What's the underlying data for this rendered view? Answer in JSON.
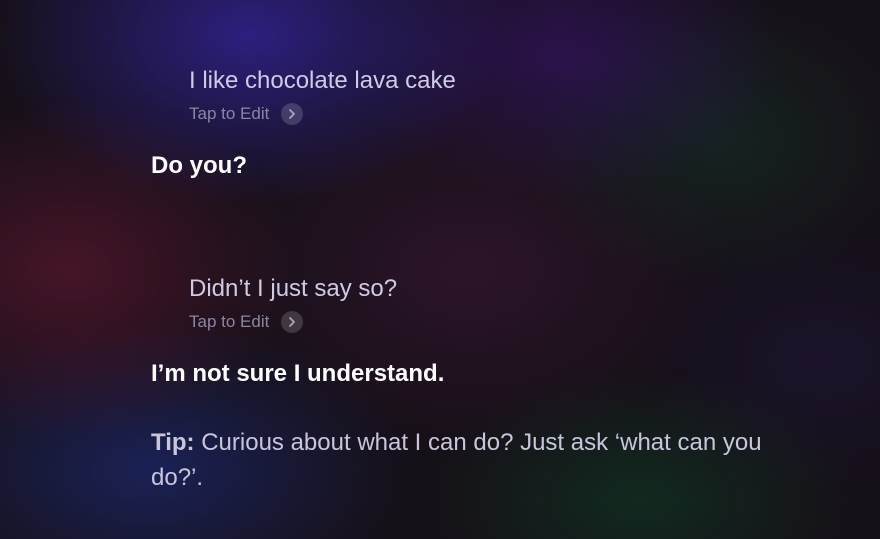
{
  "conversation": {
    "exchanges": [
      {
        "user_text": "I like chocolate lava cake",
        "edit_label": "Tap to Edit",
        "siri_reply": "Do you?"
      },
      {
        "user_text": "Didn’t I just say so?",
        "edit_label": "Tap to Edit",
        "siri_reply": "I’m not sure I understand."
      }
    ],
    "tip": {
      "label": "Tip:",
      "text": "Curious about what I can do? Just ask ‘what can you do?’."
    }
  },
  "icons": {
    "edit_chevron": "chevron-right-icon"
  },
  "colors": {
    "user_text": "#cfcbe6",
    "edit_label": "#8a86a3",
    "siri_reply": "#ffffff",
    "tip_text": "#c9c5dc"
  }
}
